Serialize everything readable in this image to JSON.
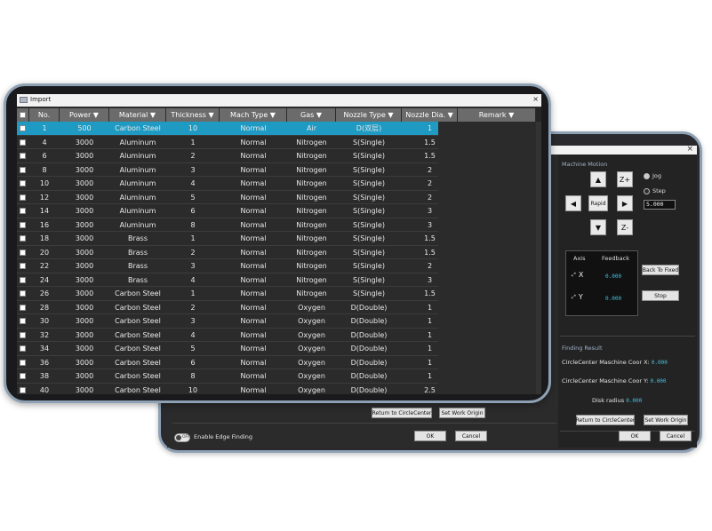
{
  "import_window": {
    "title": "Import",
    "close_glyph": "×",
    "columns": [
      "No.",
      "Power ▼",
      "Material ▼",
      "Thickness ▼",
      "Mach Type ▼",
      "Gas ▼",
      "Nozzle Type ▼",
      "Nozzle Dia. ▼",
      "Remark ▼"
    ],
    "rows": [
      {
        "no": "1",
        "power": "500",
        "material": "Carbon Steel",
        "thickness": "10",
        "mach_type": "Normal",
        "gas": "Air",
        "nozzle_type": "D(双层)",
        "nozzle_dia": "1",
        "selected": true
      },
      {
        "no": "4",
        "power": "3000",
        "material": "Aluminum",
        "thickness": "1",
        "mach_type": "Normal",
        "gas": "Nitrogen",
        "nozzle_type": "S(Single)",
        "nozzle_dia": "1.5"
      },
      {
        "no": "6",
        "power": "3000",
        "material": "Aluminum",
        "thickness": "2",
        "mach_type": "Normal",
        "gas": "Nitrogen",
        "nozzle_type": "S(Single)",
        "nozzle_dia": "1.5"
      },
      {
        "no": "8",
        "power": "3000",
        "material": "Aluminum",
        "thickness": "3",
        "mach_type": "Normal",
        "gas": "Nitrogen",
        "nozzle_type": "S(Single)",
        "nozzle_dia": "2"
      },
      {
        "no": "10",
        "power": "3000",
        "material": "Aluminum",
        "thickness": "4",
        "mach_type": "Normal",
        "gas": "Nitrogen",
        "nozzle_type": "S(Single)",
        "nozzle_dia": "2"
      },
      {
        "no": "12",
        "power": "3000",
        "material": "Aluminum",
        "thickness": "5",
        "mach_type": "Normal",
        "gas": "Nitrogen",
        "nozzle_type": "S(Single)",
        "nozzle_dia": "2"
      },
      {
        "no": "14",
        "power": "3000",
        "material": "Aluminum",
        "thickness": "6",
        "mach_type": "Normal",
        "gas": "Nitrogen",
        "nozzle_type": "S(Single)",
        "nozzle_dia": "3"
      },
      {
        "no": "16",
        "power": "3000",
        "material": "Aluminum",
        "thickness": "8",
        "mach_type": "Normal",
        "gas": "Nitrogen",
        "nozzle_type": "S(Single)",
        "nozzle_dia": "3"
      },
      {
        "no": "18",
        "power": "3000",
        "material": "Brass",
        "thickness": "1",
        "mach_type": "Normal",
        "gas": "Nitrogen",
        "nozzle_type": "S(Single)",
        "nozzle_dia": "1.5"
      },
      {
        "no": "20",
        "power": "3000",
        "material": "Brass",
        "thickness": "2",
        "mach_type": "Normal",
        "gas": "Nitrogen",
        "nozzle_type": "S(Single)",
        "nozzle_dia": "1.5"
      },
      {
        "no": "22",
        "power": "3000",
        "material": "Brass",
        "thickness": "3",
        "mach_type": "Normal",
        "gas": "Nitrogen",
        "nozzle_type": "S(Single)",
        "nozzle_dia": "2"
      },
      {
        "no": "24",
        "power": "3000",
        "material": "Brass",
        "thickness": "4",
        "mach_type": "Normal",
        "gas": "Nitrogen",
        "nozzle_type": "S(Single)",
        "nozzle_dia": "3"
      },
      {
        "no": "26",
        "power": "3000",
        "material": "Carbon Steel",
        "thickness": "1",
        "mach_type": "Normal",
        "gas": "Nitrogen",
        "nozzle_type": "S(Single)",
        "nozzle_dia": "1.5"
      },
      {
        "no": "28",
        "power": "3000",
        "material": "Carbon Steel",
        "thickness": "2",
        "mach_type": "Normal",
        "gas": "Oxygen",
        "nozzle_type": "D(Double)",
        "nozzle_dia": "1"
      },
      {
        "no": "30",
        "power": "3000",
        "material": "Carbon Steel",
        "thickness": "3",
        "mach_type": "Normal",
        "gas": "Oxygen",
        "nozzle_type": "D(Double)",
        "nozzle_dia": "1"
      },
      {
        "no": "32",
        "power": "3000",
        "material": "Carbon Steel",
        "thickness": "4",
        "mach_type": "Normal",
        "gas": "Oxygen",
        "nozzle_type": "D(Double)",
        "nozzle_dia": "1"
      },
      {
        "no": "34",
        "power": "3000",
        "material": "Carbon Steel",
        "thickness": "5",
        "mach_type": "Normal",
        "gas": "Oxygen",
        "nozzle_type": "D(Double)",
        "nozzle_dia": "1"
      },
      {
        "no": "36",
        "power": "3000",
        "material": "Carbon Steel",
        "thickness": "6",
        "mach_type": "Normal",
        "gas": "Oxygen",
        "nozzle_type": "D(Double)",
        "nozzle_dia": "1"
      },
      {
        "no": "38",
        "power": "3000",
        "material": "Carbon Steel",
        "thickness": "8",
        "mach_type": "Normal",
        "gas": "Oxygen",
        "nozzle_type": "D(Double)",
        "nozzle_dia": "1"
      },
      {
        "no": "40",
        "power": "3000",
        "material": "Carbon Steel",
        "thickness": "10",
        "mach_type": "Normal",
        "gas": "Oxygen",
        "nozzle_type": "D(Double)",
        "nozzle_dia": "2.5"
      }
    ]
  },
  "edge_window": {
    "machine_motion": {
      "title": "Machine Motion",
      "buttons": {
        "up": "▲",
        "z_plus": "Z+",
        "left": "◀",
        "rapid": "Rapid",
        "right": "▶",
        "down": "▼",
        "z_minus": "Z-"
      },
      "jog_label": "Jog",
      "step_label": "Step",
      "step_value": "5.000",
      "axis_header": "Axis",
      "feedback_header": "Feedback",
      "x_label": "X",
      "x_value": "0.000",
      "y_label": "Y",
      "y_value": "0.000",
      "back_to_fixed": "Back To Fixed",
      "stop": "Stop"
    },
    "finding_result": {
      "title": "Finding Result",
      "coor_x_label": "CircleCenter Maschine Coor X:",
      "coor_x_value": "0.000",
      "coor_y_label": "CircleCenter Maschine Coor Y:",
      "coor_y_value": "0.000",
      "disk_radius_label": "Disk radius",
      "disk_radius_value": "0.000"
    },
    "left_buttons": {
      "return": "Return to CircleCenter",
      "set_origin": "Set Work Origin"
    },
    "right_buttons": {
      "return": "Return to CircleCenter",
      "set_origin": "Set Work Origin"
    },
    "toggle_state": "OFF",
    "enable_edge_finding": "Enable Edge Finding",
    "ok": "OK",
    "cancel": "Cancel",
    "ok2": "OK",
    "cancel2": "Cancel",
    "close_glyph": "×"
  }
}
